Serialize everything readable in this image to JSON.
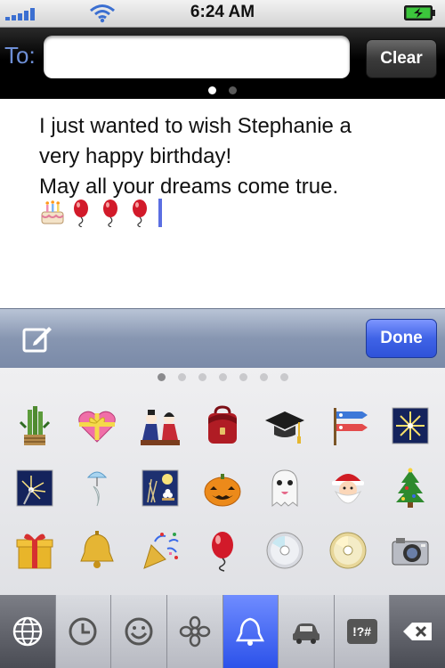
{
  "status_bar": {
    "time": "6:24 AM"
  },
  "header": {
    "to_label": "To:",
    "to_value": "",
    "clear_label": "Clear",
    "page_count": 2,
    "page_index": 0
  },
  "message": {
    "lines": [
      "I just wanted to wish Stephanie a",
      "very happy birthday!",
      "May all your dreams come true."
    ],
    "emoji": [
      "birthday-cake",
      "balloon",
      "balloon",
      "balloon"
    ]
  },
  "toolbar": {
    "done_label": "Done"
  },
  "keyboard": {
    "page_count": 7,
    "page_index": 0,
    "rows": [
      [
        "kadomatsu-icon",
        "gift-heart-icon",
        "hina-dolls-icon",
        "school-bag-icon",
        "graduation-cap-icon",
        "carp-streamer-icon",
        "fireworks-icon"
      ],
      [
        "sparkler-icon",
        "wind-chime-icon",
        "moon-ceremony-icon",
        "jack-o-lantern-icon",
        "ghost-icon",
        "santa-icon",
        "christmas-tree-icon"
      ],
      [
        "gift-icon",
        "bell-icon",
        "party-popper-icon",
        "balloon-icon",
        "cd-icon",
        "dvd-icon",
        "camera-icon"
      ]
    ]
  },
  "categories": {
    "tabs": [
      "globe-icon",
      "recent-clock-icon",
      "smiley-icon",
      "flower-icon",
      "bell-icon",
      "car-icon",
      "symbols-icon",
      "delete-icon"
    ],
    "active_index": 4,
    "symbols_label": "!?#"
  },
  "colors": {
    "accent_blue": "#3f63e6",
    "cursor": "#5b6fe2",
    "to_label": "#6e8fd6"
  }
}
